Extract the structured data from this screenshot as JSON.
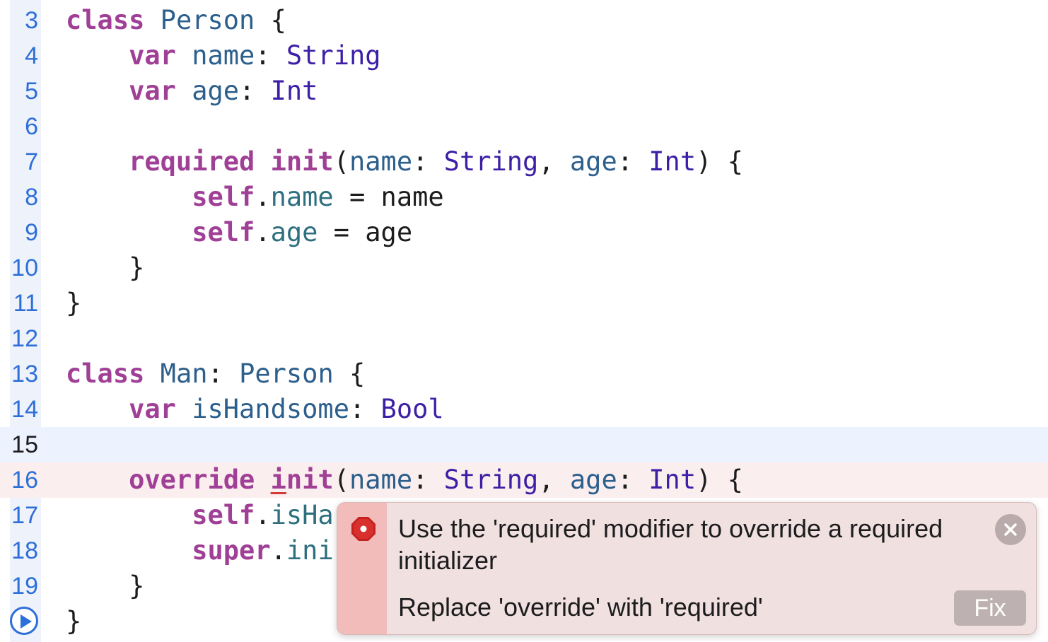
{
  "editor": {
    "lines": [
      {
        "num": "3",
        "code": "class Person {"
      },
      {
        "num": "4",
        "code": "    var name: String"
      },
      {
        "num": "5",
        "code": "    var age: Int"
      },
      {
        "num": "6",
        "code": ""
      },
      {
        "num": "7",
        "code": "    required init(name: String, age: Int) {"
      },
      {
        "num": "8",
        "code": "        self.name = name"
      },
      {
        "num": "9",
        "code": "        self.age = age"
      },
      {
        "num": "10",
        "code": "    }"
      },
      {
        "num": "11",
        "code": "}"
      },
      {
        "num": "12",
        "code": ""
      },
      {
        "num": "13",
        "code": "class Man: Person {"
      },
      {
        "num": "14",
        "code": "    var isHandsome: Bool"
      },
      {
        "num": "15",
        "code": ""
      },
      {
        "num": "16",
        "code": "    override init(name: String, age: Int) {"
      },
      {
        "num": "17",
        "code": "        self.isHa"
      },
      {
        "num": "18",
        "code": "        super.ini"
      },
      {
        "num": "19",
        "code": "    }"
      },
      {
        "num": "",
        "code": "}"
      }
    ],
    "current_line": "15",
    "error_line": "16"
  },
  "tokens": {
    "l3": [
      "class",
      " ",
      "Person",
      " {"
    ],
    "l4": [
      "    ",
      "var",
      " ",
      "name",
      ": ",
      "String"
    ],
    "l5": [
      "    ",
      "var",
      " ",
      "age",
      ": ",
      "Int"
    ],
    "l7": [
      "    ",
      "required",
      " ",
      "init",
      "(",
      "name",
      ": ",
      "String",
      ", ",
      "age",
      ": ",
      "Int",
      ") {"
    ],
    "l8": [
      "        ",
      "self",
      ".",
      "name",
      " = name"
    ],
    "l9": [
      "        ",
      "self",
      ".",
      "age",
      " = age"
    ],
    "l10": [
      "    }"
    ],
    "l11": [
      "}"
    ],
    "l13": [
      "class",
      " ",
      "Man",
      ": ",
      "Person",
      " {"
    ],
    "l14": [
      "    ",
      "var",
      " ",
      "isHandsome",
      ": ",
      "Bool"
    ],
    "l16": [
      "    ",
      "override",
      " ",
      "i",
      "nit",
      "(",
      "name",
      ": ",
      "String",
      ", ",
      "age",
      ": ",
      "Int",
      ") {"
    ],
    "l17": [
      "        ",
      "self",
      ".",
      "isHa"
    ],
    "l18": [
      "        ",
      "super",
      ".",
      "ini"
    ],
    "l19": [
      "    }"
    ],
    "l20": [
      "}"
    ]
  },
  "popup": {
    "message": "Use the 'required' modifier to override a required initializer",
    "fix_description": "Replace 'override' with 'required'",
    "fix_label": "Fix",
    "icon": "error-stop-icon",
    "close_icon": "close-icon"
  },
  "gutter": {
    "run_icon": "play-icon"
  },
  "colors": {
    "keyword": "#a03f96",
    "type": "#3d1fa6",
    "identifier": "#2c5f8c",
    "line_number": "#2d6fd8",
    "current_line_bg": "#ecf3ff",
    "error_line_bg": "#fbeeee",
    "error_red": "#c4221f"
  }
}
